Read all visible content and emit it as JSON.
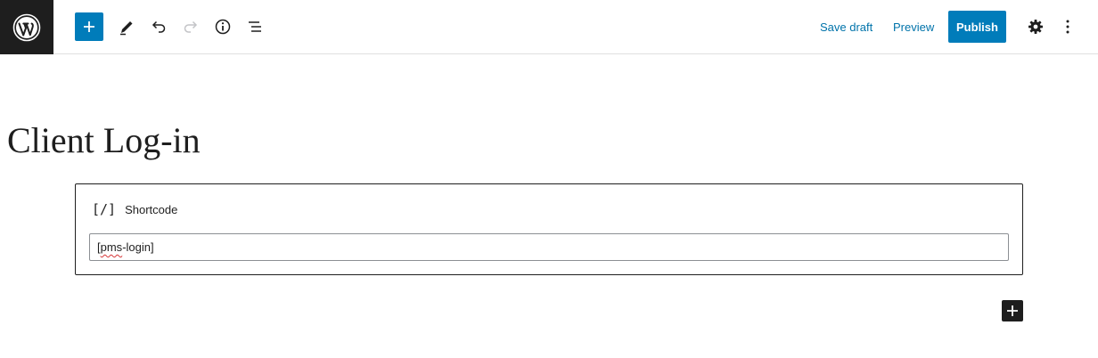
{
  "toolbar": {
    "save_draft": "Save draft",
    "preview": "Preview",
    "publish": "Publish"
  },
  "editor": {
    "title": "Client Log-in",
    "shortcode_block": {
      "icon_text": "[/]",
      "label": "Shortcode",
      "value_prefix": "[",
      "value_misspelled": "pms",
      "value_suffix": "-login]"
    }
  },
  "colors": {
    "accent": "#007cba",
    "dark": "#1e1e1e",
    "link": "#0073aa"
  },
  "icons": [
    "wordpress-logo-icon",
    "plus-icon",
    "pencil-icon",
    "undo-icon",
    "redo-icon",
    "info-icon",
    "list-view-icon",
    "gear-icon",
    "more-vertical-icon"
  ]
}
